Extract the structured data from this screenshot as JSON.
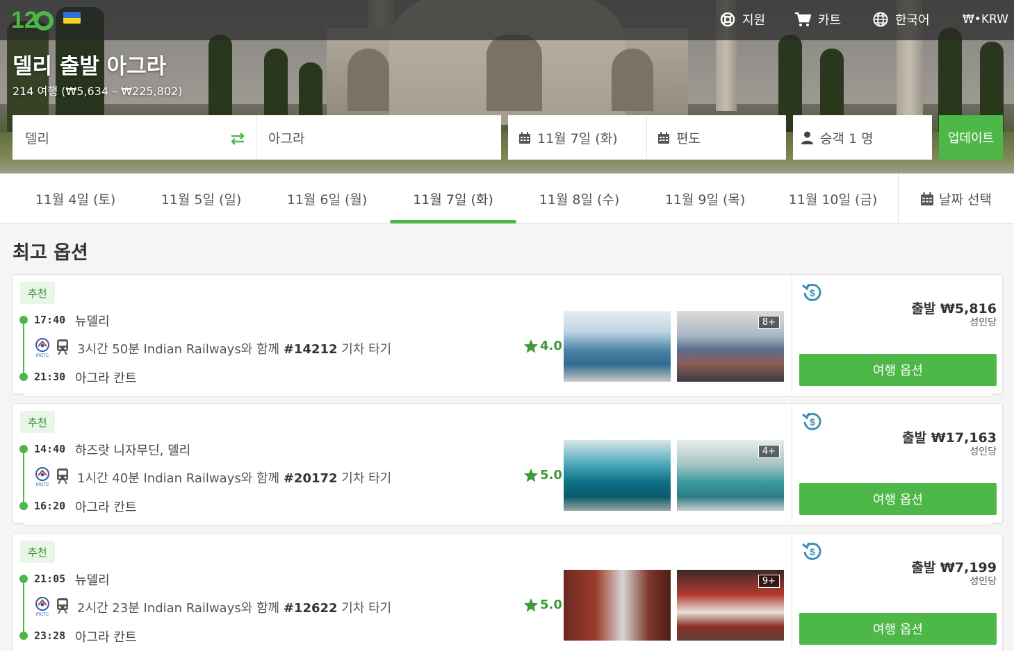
{
  "header": {
    "nav": [
      {
        "label": "지원",
        "icon": "lifebuoy-icon"
      },
      {
        "label": "카트",
        "icon": "cart-icon"
      },
      {
        "label": "한국어",
        "icon": "globe-icon"
      },
      {
        "label": "₩•KRW",
        "icon": ""
      }
    ]
  },
  "route": {
    "title": "델리 출발 아그라",
    "subtitle": "214 여행 (₩5,634 – ₩225,802)"
  },
  "search": {
    "from": "델리",
    "to": "아그라",
    "date": "11월 7일 (화)",
    "return": "편도",
    "passengers": "승객 1 명",
    "update_label": "업데이트"
  },
  "dates": [
    {
      "label": "11월 4일 (토)",
      "active": false
    },
    {
      "label": "11월 5일 (일)",
      "active": false
    },
    {
      "label": "11월 6일 (월)",
      "active": false
    },
    {
      "label": "11월 7일 (화)",
      "active": true
    },
    {
      "label": "11월 8일 (수)",
      "active": false
    },
    {
      "label": "11월 9일 (목)",
      "active": false
    },
    {
      "label": "11월 10일 (금)",
      "active": false
    }
  ],
  "date_picker_label": "날짜 선택",
  "section_title": "최고 옵션",
  "trips": [
    {
      "badge": "추천",
      "dep_time": "17:40",
      "dep_station": "뉴델리",
      "arr_time": "21:30",
      "arr_station": "아그라 칸트",
      "desc_prefix": "3시간 50분 Indian Railways와 함께 ",
      "train_no": "#14212",
      "desc_suffix": " 기차 타기",
      "rating": "4.0",
      "photo_count": "8+",
      "price": "출발 ₩5,816",
      "per": "성인당",
      "button": "여행 옵션"
    },
    {
      "badge": "추천",
      "dep_time": "14:40",
      "dep_station": "하즈랏 니자무딘, 델리",
      "arr_time": "16:20",
      "arr_station": "아그라 칸트",
      "desc_prefix": "1시간 40분 Indian Railways와 함께 ",
      "train_no": "#20172",
      "desc_suffix": " 기차 타기",
      "rating": "5.0",
      "photo_count": "4+",
      "price": "출발 ₩17,163",
      "per": "성인당",
      "button": "여행 옵션"
    },
    {
      "badge": "추천",
      "dep_time": "21:05",
      "dep_station": "뉴델리",
      "arr_time": "23:28",
      "arr_station": "아그라 칸트",
      "desc_prefix": "2시간 23분 Indian Railways와 함께 ",
      "train_no": "#12622",
      "desc_suffix": " 기차 타기",
      "rating": "5.0",
      "photo_count": "9+",
      "price": "출발 ₩7,199",
      "per": "성인당",
      "button": "여행 옵션"
    }
  ],
  "colors": {
    "accent": "#4db748",
    "refund": "#3f8fb5"
  }
}
